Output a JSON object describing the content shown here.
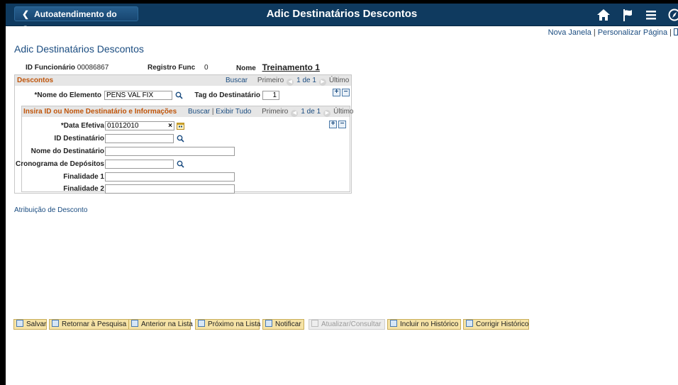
{
  "header": {
    "back_label": "Autoatendimento do Gerente",
    "title": "Adic Destinatários Descontos",
    "icons": [
      "home-icon",
      "flag-icon",
      "menu-icon",
      "navbar-icon"
    ]
  },
  "top_links": {
    "new_window": "Nova Janela",
    "sep": "|",
    "personalize": "Personalizar Página",
    "sep2": "|"
  },
  "page_title": "Adic Destinatários Descontos",
  "employee": {
    "id_label": "ID Funcionário",
    "id_value": "00086867",
    "reg_label": "Registro Func",
    "reg_value": "0",
    "name_label": "Nome",
    "name_value": "Treinamento 1"
  },
  "descontos": {
    "title": "Descontos",
    "search": "Buscar",
    "first": "Primeiro",
    "count": "1 de 1",
    "last": "Último",
    "element_label": "*Nome do Elemento",
    "element_value": "PENS VAL FIX",
    "tag_label": "Tag do Destinatário",
    "tag_value": "1"
  },
  "destinatario": {
    "title": "Insira ID ou Nome Destinatário e Informações",
    "search": "Buscar",
    "sep": "|",
    "view_all": "Exibir Tudo",
    "first": "Primeiro",
    "count": "1 de 1",
    "last": "Último",
    "date_label": "*Data Efetiva",
    "date_value": "01012010",
    "date_clear": "×",
    "id_label": "ID Destinatário",
    "id_value": "",
    "name_label": "Nome do Destinatário",
    "name_value": "",
    "schedule_label": "Cronograma de Depósitos",
    "schedule_value": "",
    "purpose1_label": "Finalidade 1",
    "purpose1_value": "",
    "purpose2_label": "Finalidade 2",
    "purpose2_value": ""
  },
  "attribution_link": "Atribuição de Desconto",
  "toolbar": {
    "save": "Salvar",
    "return": "Retornar à Pesquisa",
    "previous": "Anterior na Lista",
    "next": "Próximo na Lista",
    "notify": "Notificar",
    "refresh": "Atualizar/Consultar",
    "include_history": "Incluir no Histórico",
    "correct_history": "Corrigir Histórico"
  },
  "colors": {
    "header_bg": "#0f3a5f",
    "link": "#1a4c80",
    "section_title": "#c0550a",
    "button_bg": "#f6e3a6"
  }
}
